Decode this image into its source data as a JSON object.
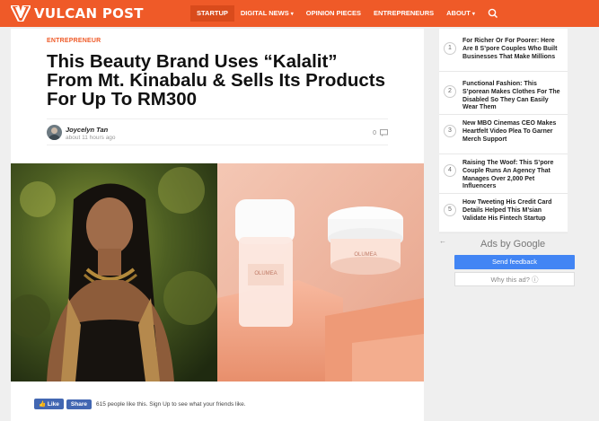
{
  "header": {
    "brand": "VULCAN POST",
    "nav": [
      {
        "label": "STARTUP",
        "active": true,
        "dropdown": false
      },
      {
        "label": "DIGITAL NEWS",
        "active": false,
        "dropdown": true
      },
      {
        "label": "OPINION PIECES",
        "active": false,
        "dropdown": false
      },
      {
        "label": "ENTREPRENEURS",
        "active": false,
        "dropdown": false
      },
      {
        "label": "ABOUT",
        "active": false,
        "dropdown": true
      }
    ],
    "caret": "▾",
    "search_icon": "search-icon"
  },
  "article": {
    "category": "ENTREPRENEUR",
    "headline": "This Beauty Brand Uses “Kalalit” From Mt. Kinabalu & Sells Its Products For Up To RM300",
    "author": "Joycelyn Tan",
    "timestamp": "about 11 hours ago",
    "comment_count": "0",
    "hero_jar_label_1": "OLUMEA",
    "hero_jar_label_2": "OLUMEA"
  },
  "social": {
    "like_label": "Like",
    "share_label": "Share",
    "like_text": "615 people like this. Sign Up to see what your friends like."
  },
  "sidebar": {
    "items": [
      {
        "num": "1",
        "title": "For Richer Or For Poorer: Here Are 8 S’pore Couples Who Built Businesses That Make Millions"
      },
      {
        "num": "2",
        "title": "Functional Fashion: This S’porean Makes Clothes For The Disabled So They Can Easily Wear Them"
      },
      {
        "num": "3",
        "title": "New MBO Cinemas CEO Makes Heartfelt Video Plea To Garner Merch Support"
      },
      {
        "num": "4",
        "title": "Raising The Woof: This S’pore Couple Runs An Agency That Manages Over 2,000 Pet Influencers"
      },
      {
        "num": "5",
        "title": "How Tweeting His Credit Card Details Helped This M’sian Validate His Fintech Startup"
      }
    ]
  },
  "ad": {
    "back": "←",
    "ads_by": "Ads by Google",
    "send_feedback": "Send feedback",
    "why_ad": "Why this ad?",
    "info_icon": "ⓘ"
  },
  "colors": {
    "brand": "#ef5a28",
    "facebook": "#4267b2",
    "google_blue": "#4285f4"
  }
}
